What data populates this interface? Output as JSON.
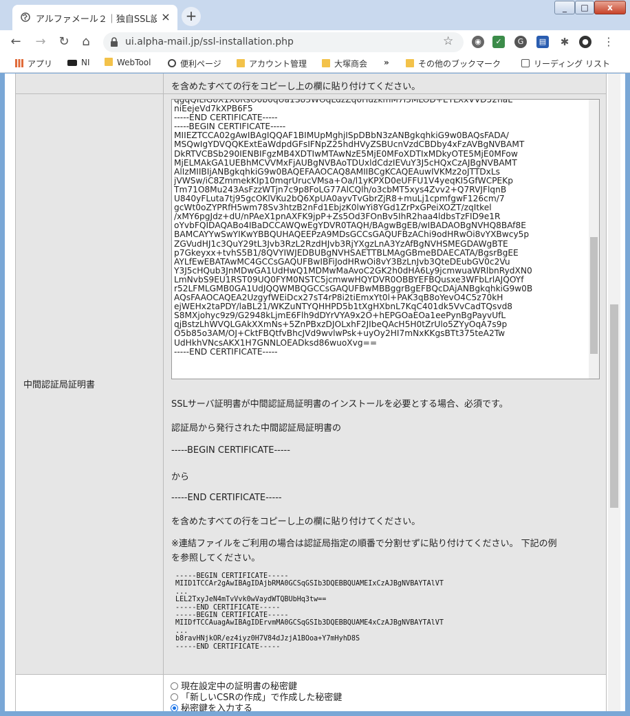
{
  "tab": {
    "title": "アルファメール２｜独自SSL設定",
    "close": "×",
    "new_tab": "+"
  },
  "window_controls": {
    "minimize": "_",
    "maximize": "□",
    "close": "x"
  },
  "address": {
    "url": "ui.alpha-mail.jp/ssl-installation.php"
  },
  "bookmarks": [
    {
      "label": "アプリ",
      "icon": "apps-grid-icon"
    },
    {
      "label": "NI",
      "icon": "ni-logo-icon"
    },
    {
      "label": "WebTool",
      "icon": "folder-icon"
    },
    {
      "label": "便利ページ",
      "icon": "globe-icon"
    },
    {
      "label": "アカウント管理",
      "icon": "folder-icon"
    },
    {
      "label": "大塚商会",
      "icon": "folder-icon"
    },
    {
      "label": "»",
      "icon": "chevron-more-icon"
    },
    {
      "label": "その他のブックマーク",
      "icon": "folder-icon"
    },
    {
      "label": "リーディング リスト",
      "icon": "reading-list-icon"
    }
  ],
  "top_row": {
    "text": "を含めたすべての行をコピーし上の欄に貼り付けてください。"
  },
  "intermediate": {
    "label": "中間認証局証明書",
    "textarea_value": "qgqQILIG0X1X0RsO0b0qUa1S83WOqLdzZq0HuzkmM7I3MLOD+EYLXxVVD52naL\nniEejeVd7kXPB6F5\n-----END CERTIFICATE-----\n-----BEGIN CERTIFICATE-----\nMIIEZTCCA02gAwIBAgIQQAF1BIMUpMghjISpDBbN3zANBgkqhkiG9w0BAQsFADA/\nMSQwIgYDVQQKExtEaWdpdGFsIFNpZ25hdHVyZSBUcnVzdCBDby4xFzAVBgNVBAMT\nDkRTVCBSb290IENBIFgzMB4XDTIwMTAwNzE5MjE0MFoXDTIxMDkyOTE5MjE0MFow\nMjELMAkGA1UEBhMCVVMxFjAUBgNVBAoTDUxldCdzIEVuY3J5cHQxCzAJBgNVBAMT\nAlIzMIIBIjANBgkqhkiG9w0BAQEFAAOCAQ8AMIIBCgKCAQEAuwIVKMz2oJTTDxLs\njVWSw/iC8ZmmekKIp10mqrUrucVMsa+Oa/l1yKPXD0eUFFU1V4yeqKI5GfWCPEKp\nTm71O8Mu243AsFzzWTjn7c9p8FoLG77AlCQlh/o3cbMT5xys4Zvv2+Q7RVJFlqnB\nU840yFLuta7tj95gcOKlVKu2bQ6XpUA0ayvTvGbrZjR8+muLj1cpmfgwF126cm/7\ngcWt0oZYPRfH5wm78Sv3htzB2nFd1EbjzK0lwYi8YGd1ZrPxGPeiXOZT/zqItkel\n/xMY6pgJdz+dU/nPAeX1pnAXFK9jpP+Zs5Od3FOnBv5IhR2haa4ldbsTzFID9e1R\noYvbFQIDAQABo4IBaDCCAWQwEgYDVR0TAQH/BAgwBgEB/wIBADAOBgNVHQ8BAf8E\nBAMCAYYwSwYIKwYBBQUHAQEEPzA9MDsGCCsGAQUFBzAChi9odHRwOi8vYXBwcy5p\nZGVudHJ1c3QuY29tL3Jvb3RzL2RzdHJvb3RjYXgzLnA3YzAfBgNVHSMEGDAWgBTE\np7Gkeyxx+tvhS5B1/8QVYIWJEDBUBgNVHSAETTBLMAgGBmeBDAECATA/BgsrBgEE\nAYLfEwEBATAwMC4GCCsGAQUFBwIBFiJodHRwOi8vY3BzLnJvb3QteDEubGV0c2Vu\nY3J5cHQub3JnMDwGA1UdHwQ1MDMwMaAvoC2GK2h0dHA6Ly9jcmwuaWRlbnRydXN0\nLmNvbS9EU1RST09UQ0FYM0NSTC5jcmwwHQYDVR0OBBYEFBQusxe3WFbLrlAJQOYf\nr52LFMLGMB0GA1UdJQQWMBQGCCsGAQUFBwMBBggrBgEFBQcDAjANBgkqhkiG9w0B\nAQsFAAOCAQEA2UzgyfWEiDcx27sT4rP8i2tiEmxYt0l+PAK3qB8oYevO4C5z70kH\nejWEHx2taPDY/laBL21/WKZuNTYQHHPD5b1tXgHXbnL7KqC401dk5VvCadTQsvd8\nS8MXjohyc9z9/G2948kLjmE6Flh9dDYrVYA9x2O+hEPGOaEOa1eePynBgPayvUfL\nqjBstzLhWVQLGAkXXmNs+5ZnPBxzDJOLxhF2JIbeQAcH5H0tZrUlo5ZYyOqA7s9p\nO5b85o3AM/OJ+CktFBQtfvBhcJVd9wvlwPsk+uyOy2HI7mNxKKgsBTt375teA2Tw\nUdHkhVNcsAKX1H7GNNLOEADksd86wuoXvg==\n-----END CERTIFICATE-----",
    "desc1": "SSLサーバ証明書が中間認証局証明書のインストールを必要とする場合、必須です。",
    "desc2": "認証局から発行された中間認証局証明書の",
    "desc3": "-----BEGIN CERTIFICATE-----",
    "desc4": "から",
    "desc5": "-----END CERTIFICATE-----",
    "desc6": "を含めたすべての行をコピーし上の欄に貼り付けてください。",
    "note1": "※連結ファイルをご利用の場合は認証局指定の順番で分割せずに貼り付けてください。 下記の例",
    "note2": "を参照してください。",
    "example": "-----BEGIN CERTIFICATE-----\nMIID1TCCAr2gAwIBAgIDAjbRMA0GCSqGSIb3DQEBBQUAMEIxCzAJBgNVBAYTAlVT\n...\nLEL2TxyJeN4mTvVvk0wVaydWTQBUbHq3tw==\n-----END CERTIFICATE-----\n-----BEGIN CERTIFICATE-----\nMIIDfTCCAuagAwIBAgIDErvmMA0GCSqGSIb3DQEBBQUAME4xCzAJBgNVBAYTAlVT\n...\nb8ravHNjkOR/ez4iyz0H7V84dJzjA1BOoa+Y7mHyhD8S\n-----END CERTIFICATE-----"
  },
  "private_key": {
    "options": [
      {
        "label": "現在設定中の証明書の秘密鍵",
        "selected": false
      },
      {
        "label": "「新しいCSRの作成」で作成した秘密鍵",
        "selected": false
      },
      {
        "label": "秘密鍵を入力する",
        "selected": true
      }
    ]
  }
}
